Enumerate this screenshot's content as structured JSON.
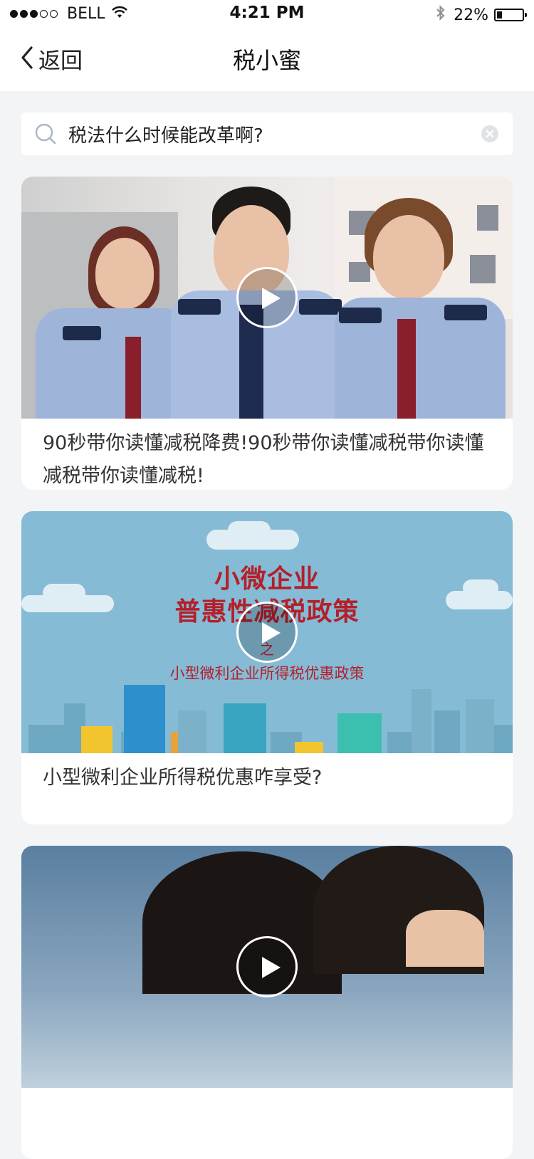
{
  "status_bar": {
    "carrier": "BELL",
    "time": "4:21 PM",
    "battery": "22%",
    "battery_level": 0.22,
    "signal_filled": 3,
    "signal_total": 5
  },
  "nav": {
    "back_label": "返回",
    "title": "税小蜜"
  },
  "search": {
    "value": "税法什么时候能改革啊?"
  },
  "cards": [
    {
      "title": "90秒带你读懂减税降费!90秒带你读懂减税带你读懂减税带你读懂减税!"
    },
    {
      "title": "小型微利企业所得税优惠咋享受?",
      "thumb_text": {
        "line1": "小微企业",
        "line2": "普惠性减税政策",
        "zhi": "之",
        "sub": "小型微利企业所得税优惠政策"
      }
    },
    {
      "title": ""
    }
  ],
  "colors": {
    "background": "#f2f4f6",
    "card": "#ffffff",
    "title_text": "#333333",
    "cartoon_red": "#b3202a"
  }
}
